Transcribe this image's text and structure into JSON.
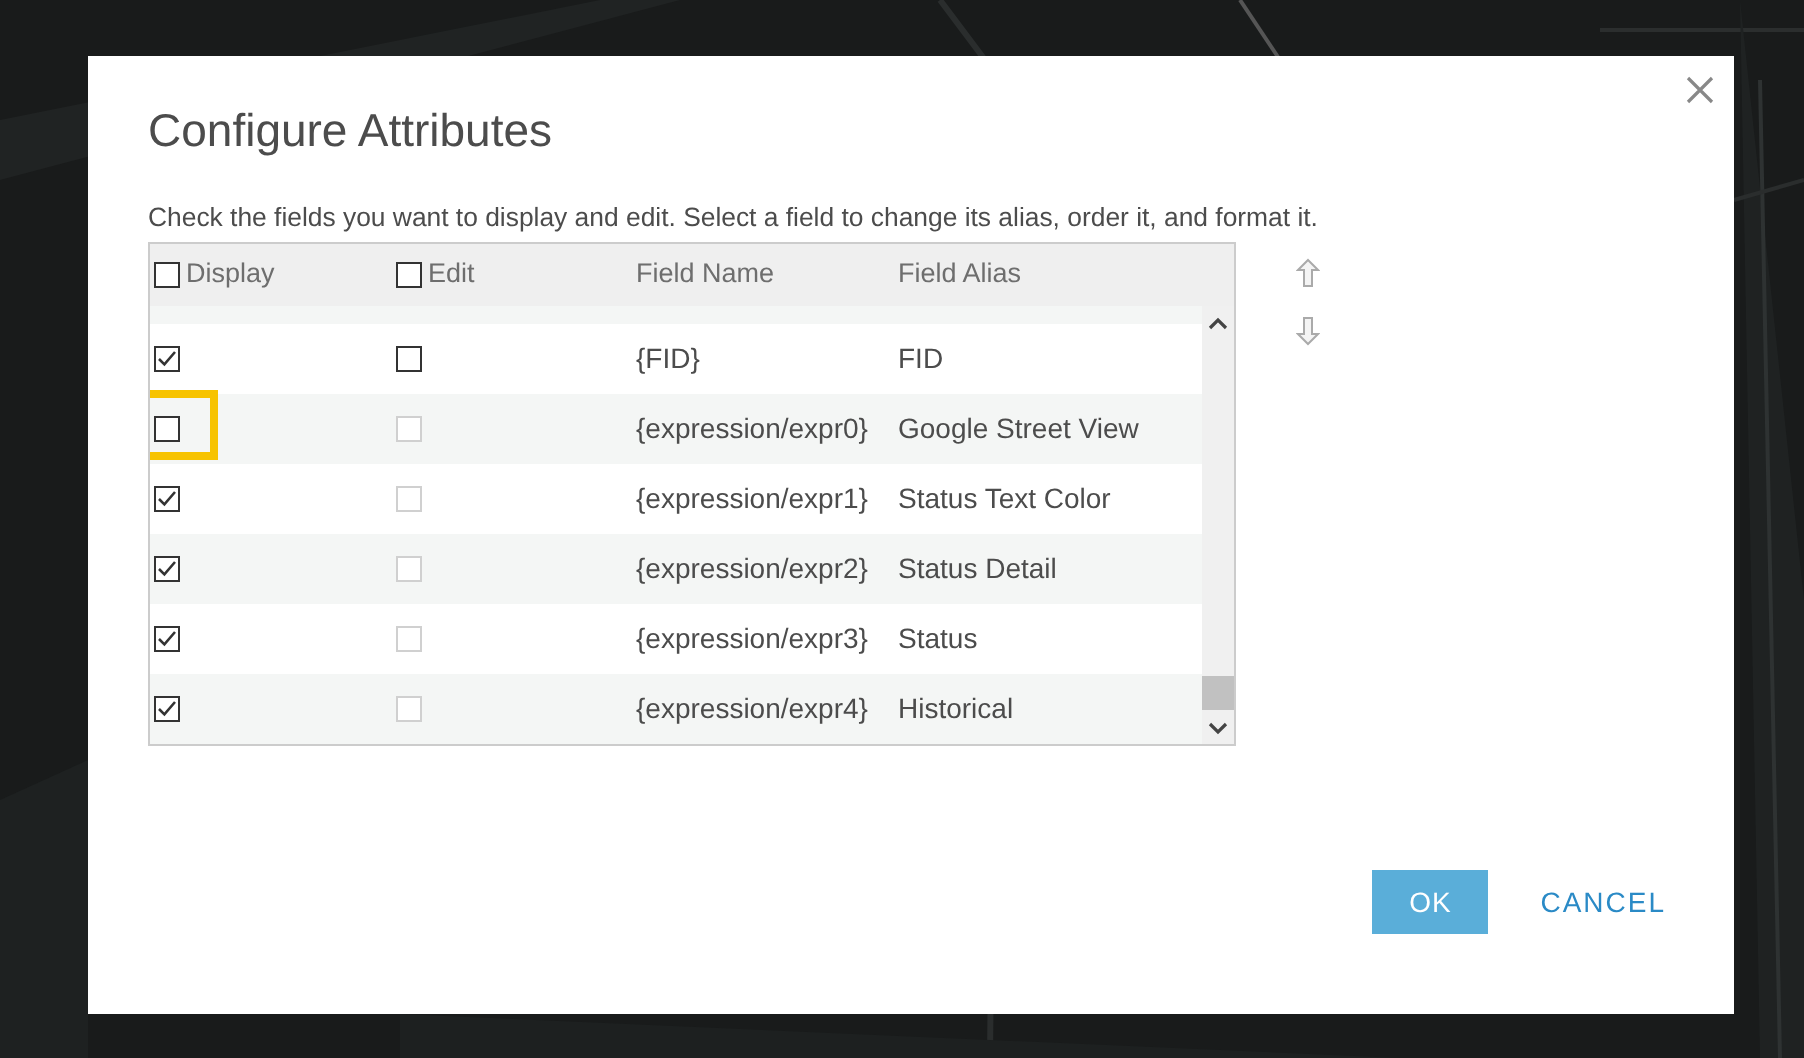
{
  "dialog": {
    "title": "Configure Attributes",
    "instructions": "Check the fields you want to display and edit. Select a field to change its alias, order it, and format it."
  },
  "table": {
    "columns": [
      {
        "label": "Display",
        "kind": "checkbox",
        "checked": false
      },
      {
        "label": "Edit",
        "kind": "checkbox",
        "checked": false
      },
      {
        "label": "Field Name",
        "kind": "text"
      },
      {
        "label": "Field Alias",
        "kind": "text"
      }
    ],
    "rows": [
      {
        "display": true,
        "edit": false,
        "edit_disabled": false,
        "highlighted": false,
        "field_name": "{FID}",
        "field_alias": "FID"
      },
      {
        "display": false,
        "edit": false,
        "edit_disabled": true,
        "highlighted": true,
        "field_name": "{expression/expr0}",
        "field_alias": "Google Street View"
      },
      {
        "display": true,
        "edit": false,
        "edit_disabled": true,
        "highlighted": false,
        "field_name": "{expression/expr1}",
        "field_alias": "Status Text Color"
      },
      {
        "display": true,
        "edit": false,
        "edit_disabled": true,
        "highlighted": false,
        "field_name": "{expression/expr2}",
        "field_alias": "Status Detail"
      },
      {
        "display": true,
        "edit": false,
        "edit_disabled": true,
        "highlighted": false,
        "field_name": "{expression/expr3}",
        "field_alias": "Status"
      },
      {
        "display": true,
        "edit": false,
        "edit_disabled": true,
        "highlighted": false,
        "field_name": "{expression/expr4}",
        "field_alias": "Historical"
      }
    ]
  },
  "buttons": [
    {
      "label": "OK",
      "kind": "primary"
    },
    {
      "label": "CANCEL",
      "kind": "link"
    }
  ]
}
